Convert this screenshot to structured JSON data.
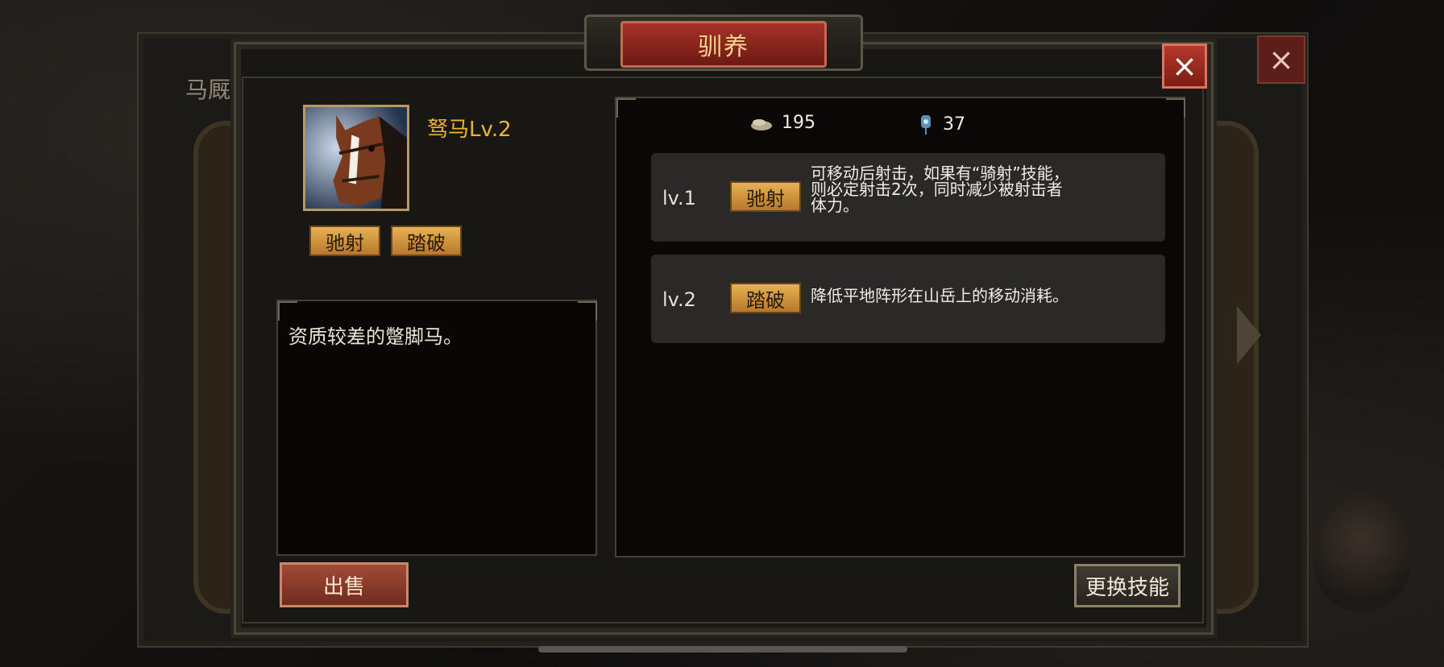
{
  "background": {
    "tab_label": "马厩"
  },
  "dialog": {
    "title": "驯养",
    "close_icon": "close-icon"
  },
  "horse": {
    "name": "驽马Lv.2",
    "skills": [
      "驰射",
      "踏破"
    ],
    "description": "资质较差的蹩脚马。"
  },
  "resources": [
    {
      "icon": "fodder-icon",
      "value": "195"
    },
    {
      "icon": "lantern-icon",
      "value": "37"
    }
  ],
  "skill_list": [
    {
      "level": "lv.1",
      "name": "驰射",
      "lines": [
        "可移动后射击，如果有“骑射”技能，",
        "则必定射击2次，同时减少被射击者",
        "体力。"
      ]
    },
    {
      "level": "lv.2",
      "name": "踏破",
      "lines": [
        "降低平地阵形在山岳上的移动消耗。"
      ]
    }
  ],
  "buttons": {
    "sell": "出售",
    "swap_skill": "更换技能"
  },
  "colors": {
    "title_banner": "#a5332a",
    "name_gold": "#f0b432",
    "tag_gold": "#e7b155"
  }
}
